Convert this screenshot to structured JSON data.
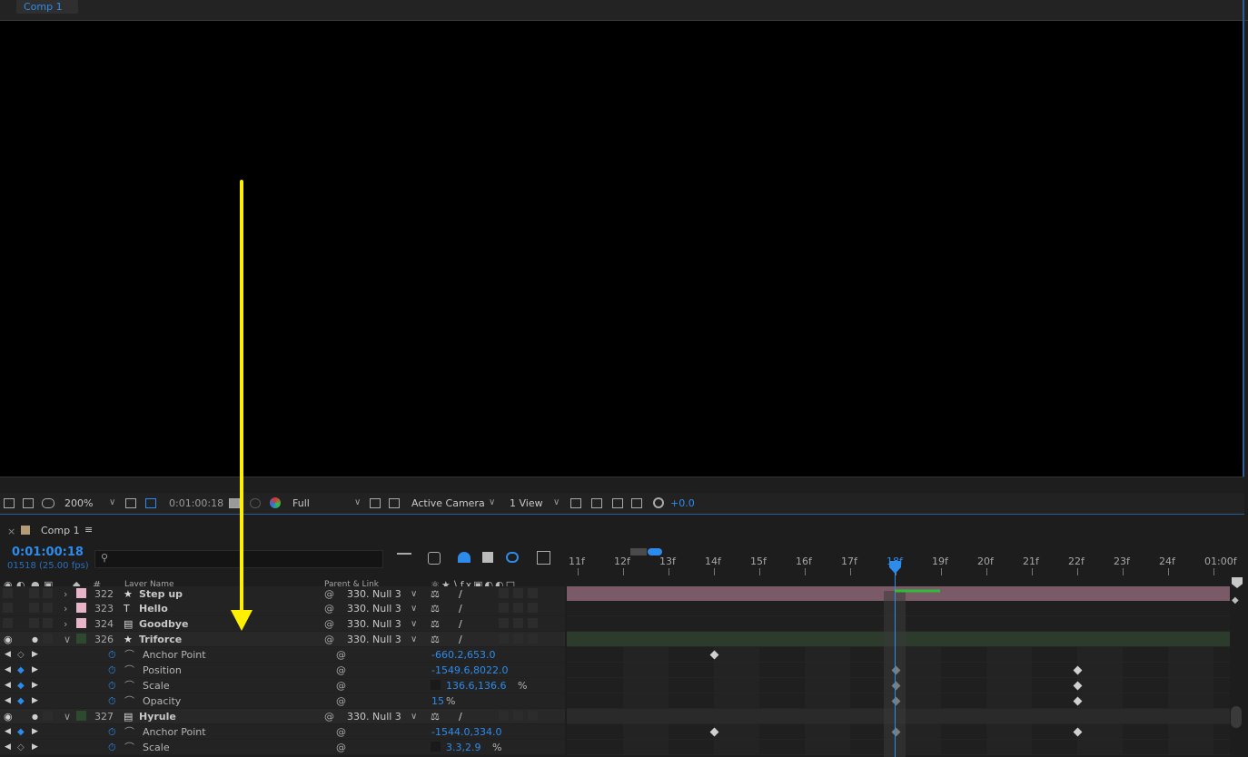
{
  "viewer": {
    "tab_label": "Comp 1",
    "toolbar": {
      "zoom": "200%",
      "timecode": "0:01:00:18",
      "resolution": "Full",
      "camera": "Active Camera",
      "views": "1 View",
      "exposure": "+0.0"
    }
  },
  "timeline": {
    "tab_label": "Comp 1",
    "current_time": "0:01:00:18",
    "frame_info": "01518 (25.00 fps)",
    "search_placeholder": "",
    "columns": {
      "hash": "#",
      "layer_name": "Layer Name",
      "parent_link": "Parent & Link"
    },
    "ruler_ticks": [
      "11f",
      "12f",
      "13f",
      "14f",
      "15f",
      "16f",
      "17f",
      "18f",
      "19f",
      "20f",
      "21f",
      "22f",
      "23f",
      "24f",
      "01:00f"
    ],
    "current_frame_label": "18f",
    "layers": [
      {
        "num": "322",
        "name": "Step up",
        "parent": "330. Null 3",
        "kind": "star",
        "expanded": false,
        "label_color": "#e8b4c8"
      },
      {
        "num": "323",
        "name": "Hello",
        "parent": "330. Null 3",
        "kind": "text",
        "expanded": false,
        "label_color": "#e8b4c8"
      },
      {
        "num": "324",
        "name": "Goodbye",
        "parent": "330. Null 3",
        "kind": "doc",
        "expanded": false,
        "label_color": "#e8b4c8"
      },
      {
        "num": "326",
        "name": "Triforce",
        "parent": "330. Null 3",
        "kind": "star",
        "expanded": true,
        "label_color": "#2e4a2e"
      },
      {
        "num": "327",
        "name": "Hyrule",
        "parent": "330. Null 3",
        "kind": "doc",
        "expanded": true,
        "label_color": "#2e4a2e"
      }
    ],
    "properties": [
      {
        "name": "Anchor Point",
        "value": "-660.2,653.0",
        "layer": "326"
      },
      {
        "name": "Position",
        "value": "-1549.6,8022.0",
        "layer": "326"
      },
      {
        "name": "Scale",
        "value": "136.6,136.6",
        "unit": "%",
        "layer": "326"
      },
      {
        "name": "Opacity",
        "value": "15",
        "unit": "%",
        "layer": "326"
      },
      {
        "name": "Anchor Point",
        "value": "-1544.0,334.0",
        "layer": "327"
      },
      {
        "name": "Scale",
        "value": "3.3,2.9",
        "unit": "%",
        "layer": "327"
      }
    ]
  },
  "annotation": {
    "arrow_color": "#ffef00"
  }
}
